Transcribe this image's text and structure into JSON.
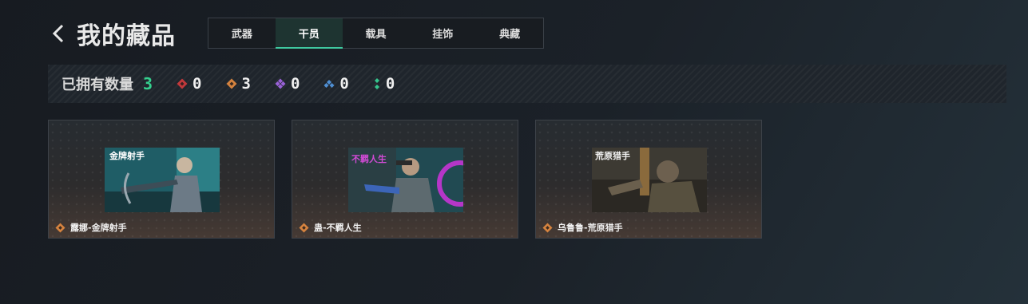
{
  "header": {
    "title": "我的藏品"
  },
  "tabs": [
    {
      "label": "武器",
      "active": false
    },
    {
      "label": "干员",
      "active": true
    },
    {
      "label": "载具",
      "active": false
    },
    {
      "label": "挂饰",
      "active": false
    },
    {
      "label": "典藏",
      "active": false
    }
  ],
  "summary": {
    "label": "已拥有数量",
    "total": "3",
    "rarities": [
      {
        "icon": "red-diamond-icon",
        "color": "#c2393b",
        "count": "0"
      },
      {
        "icon": "orange-diamond-icon",
        "color": "#d5833f",
        "count": "3"
      },
      {
        "icon": "purple-diamond-icon",
        "color": "#9a62d8",
        "count": "0"
      },
      {
        "icon": "blue-diamond-icon",
        "color": "#4f8fd3",
        "count": "0"
      },
      {
        "icon": "green-diamond-icon",
        "color": "#35c58d",
        "count": "0"
      }
    ]
  },
  "items": [
    {
      "name": "露娜-金牌射手",
      "thumb_text": "金牌射手",
      "rarity_color": "#d5833f"
    },
    {
      "name": "蛊-不羁人生",
      "thumb_text": "不羁人生",
      "rarity_color": "#d5833f"
    },
    {
      "name": "乌鲁鲁-荒原猎手",
      "thumb_text": "荒原猎手",
      "rarity_color": "#d5833f"
    }
  ]
}
